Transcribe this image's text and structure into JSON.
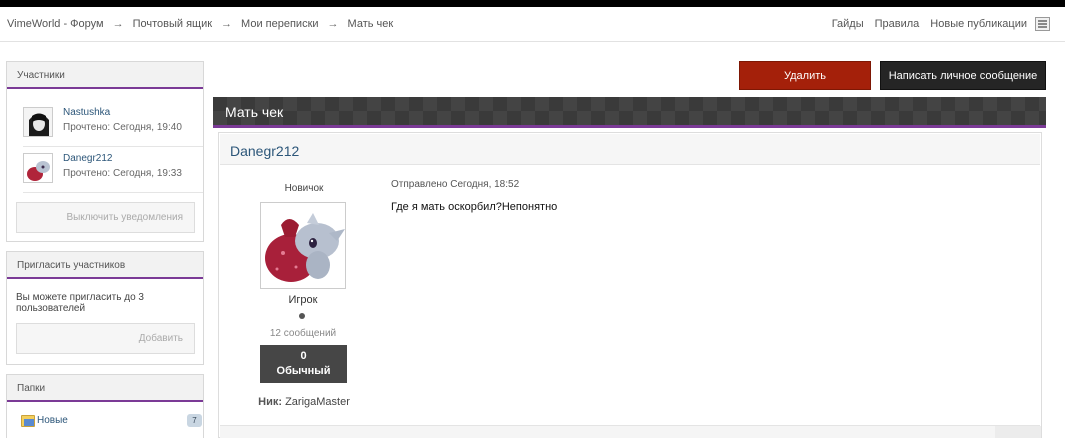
{
  "breadcrumb": {
    "items": [
      "VimeWorld - Форум",
      "Почтовый ящик",
      "Мои переписки",
      "Мать чек"
    ],
    "separator": "→"
  },
  "navbar": {
    "links": [
      "Гайды",
      "Правила",
      "Новые публикации"
    ],
    "menu_icon": "hamburger-icon"
  },
  "sidebar": {
    "participants": {
      "title": "Участники",
      "members": [
        {
          "name": "Nastushka",
          "read": "Прочтено: Сегодня, 19:40"
        },
        {
          "name": "Danegr212",
          "read": "Прочтено: Сегодня, 19:33"
        }
      ],
      "notify_button": "Выключить уведомления"
    },
    "invite": {
      "title": "Пригласить участников",
      "text": "Вы можете пригласить до 3 пользователей",
      "add_button": "Добавить"
    },
    "folders": {
      "title": "Папки",
      "items": [
        {
          "name": "Новые",
          "count": "7",
          "icon": "folder-icon"
        }
      ]
    }
  },
  "actions": {
    "delete": "Удалить",
    "write": "Написать личное сообщение"
  },
  "thread": {
    "title": "Мать чек"
  },
  "message": {
    "author": "Danegr212",
    "rank": "Новичок",
    "group": "Игрок",
    "posts": "12 сообщений",
    "reputation_value": "0",
    "reputation_label": "Обычный",
    "nick_label": "Ник:",
    "nick_value": "ZarigaMaster",
    "sent": "Отправлено Сегодня, 18:52",
    "text": "Где я мать оскорбил?Непонятно"
  },
  "colors": {
    "accent_purple": "#7b3a96",
    "delete_red": "#a4200a",
    "dark_button": "#252525",
    "link_blue": "#2c5679"
  }
}
